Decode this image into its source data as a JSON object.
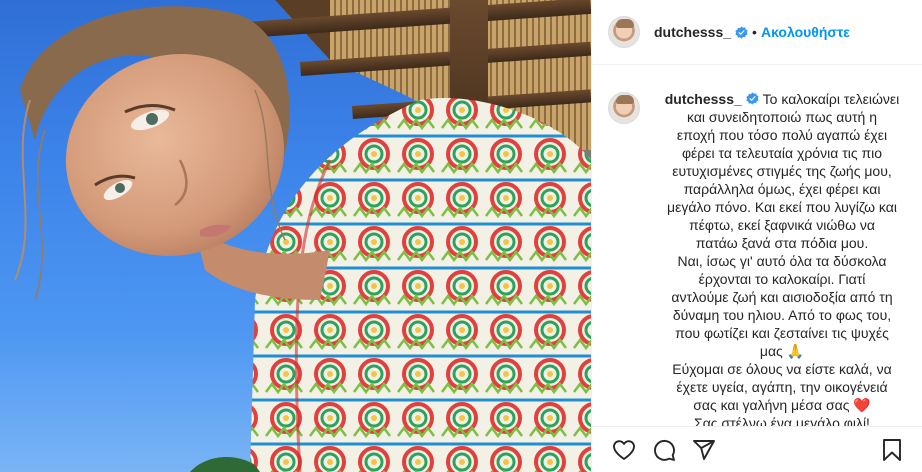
{
  "post": {
    "username": "dutchesss_",
    "verified": true,
    "follow_label": "Ακολουθήστε",
    "separator": "•",
    "caption_lines": [
      "Το καλοκαίρι τελειώνει",
      "και συνειδητοποιώ πως αυτή η",
      "εποχή που τόσο πολύ αγαπώ έχει",
      "φέρει τα τελευταία χρόνια τις πιο",
      "ευτυχισμένες στιγμές της ζωής μου,",
      "παράλληλα όμως, έχει φέρει και",
      "μεγάλο πόνο. Και εκεί που λυγίζω και",
      "πέφτω, εκεί ξαφνικά νιώθω να",
      "πατάω ξανά στα πόδια μου.",
      "Ναι, ίσως γι' αυτό όλα τα δύσκολα",
      "έρχονται το καλοκαίρι. Γιατί",
      "αντλούμε ζωή και αισιοδοξία από τη",
      "δύναμη του ηλιου. Από το φως του,",
      "που φωτίζει και ζεσταίνει τις ψυχές",
      "μας 🙏",
      "Εύχομαι σε όλους να είστε καλά, να",
      "έχετε υγεία, αγάπη, την οικογένειά",
      "σας και γαλήνη μέσα σας ❤️",
      "Σας στέλνω ένα μεγάλο φιλί!"
    ]
  },
  "icons": {
    "verified": "verified-badge-icon",
    "like": "heart-icon",
    "comment": "comment-icon",
    "share": "paper-plane-icon",
    "save": "bookmark-icon"
  },
  "colors": {
    "accent": "#0095f6",
    "text": "#262626",
    "border": "#efefef",
    "sky": "#3d84ea"
  }
}
